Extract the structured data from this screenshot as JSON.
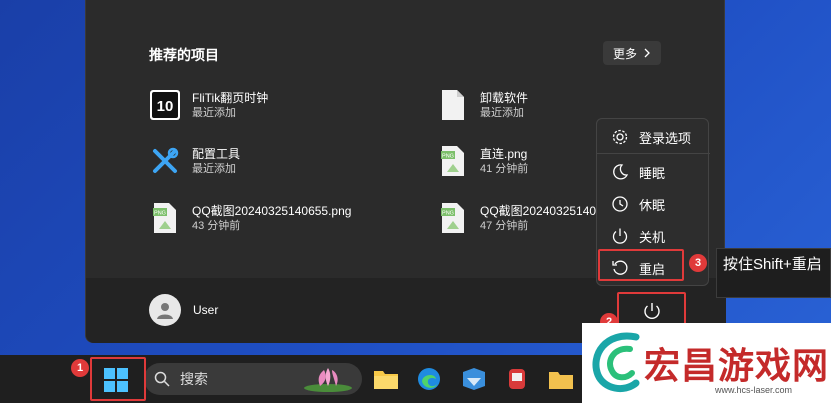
{
  "start_menu": {
    "recommended_title": "推荐的项目",
    "more_label": "更多",
    "items": [
      {
        "name": "FliTik翻页时钟",
        "time": "最近添加",
        "icon": "flitik-app-icon"
      },
      {
        "name": "卸载软件",
        "time": "最近添加",
        "icon": "file-icon"
      },
      {
        "name": "配置工具",
        "time": "最近添加",
        "icon": "tools-icon"
      },
      {
        "name": "直连.png",
        "time": "41 分钟前",
        "icon": "png-file-icon"
      },
      {
        "name": "QQ截图20240325140655.png",
        "time": "43 分钟前",
        "icon": "png-file-icon"
      },
      {
        "name": "QQ截图20240325140",
        "time": "47 分钟前",
        "icon": "png-file-icon"
      }
    ],
    "user_name": "User"
  },
  "power_menu": {
    "items": [
      "登录选项",
      "睡眠",
      "休眠",
      "关机",
      "重启"
    ]
  },
  "tooltip_text": "按住Shift+重启",
  "badges": [
    "1",
    "2",
    "3"
  ],
  "taskbar": {
    "search_placeholder": "搜索",
    "apps": [
      "file-explorer-icon",
      "edge-browser-icon",
      "app-icon",
      "app-icon",
      "folder-icon"
    ]
  },
  "watermark": {
    "title": "宏昌游戏网",
    "url": "www.hcs-laser.com"
  },
  "colors": {
    "accent_red": "#e03a3a",
    "menu_bg": "#2b2b2b",
    "taskbar_bg": "#1f1f1f",
    "watermark_red": "#c42a2a"
  }
}
